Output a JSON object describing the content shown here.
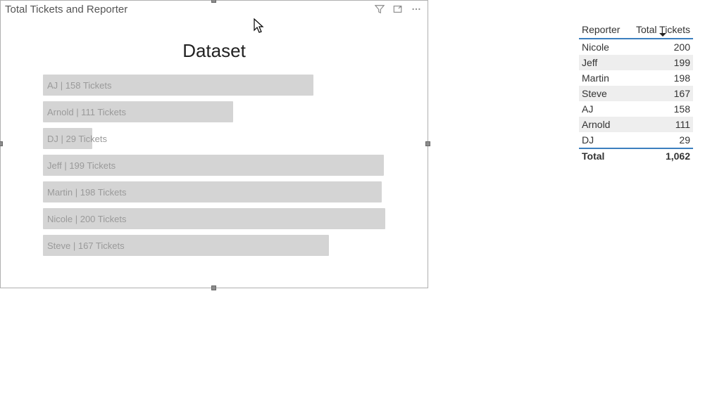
{
  "visual": {
    "title": "Total Tickets and Reporter",
    "chart_title": "Dataset"
  },
  "chart_data": {
    "type": "bar",
    "title": "Dataset",
    "xlabel": "",
    "ylabel": "",
    "orientation": "horizontal",
    "categories": [
      "AJ",
      "Arnold",
      "DJ",
      "Jeff",
      "Martin",
      "Nicole",
      "Steve"
    ],
    "values": [
      158,
      111,
      29,
      199,
      198,
      200,
      167
    ],
    "bar_labels": [
      "AJ | 158 Tickets",
      "Arnold | 111 Tickets",
      "DJ | 29 Tickets",
      "Jeff | 199 Tickets",
      "Martin | 198 Tickets",
      "Nicole | 200 Tickets",
      "Steve | 167 Tickets"
    ],
    "max_value": 200
  },
  "table": {
    "columns": [
      "Reporter",
      "Total Tickets"
    ],
    "sort_column": "Total Tickets",
    "sort_direction": "desc",
    "rows": [
      {
        "reporter": "Nicole",
        "tickets": "200"
      },
      {
        "reporter": "Jeff",
        "tickets": "199"
      },
      {
        "reporter": "Martin",
        "tickets": "198"
      },
      {
        "reporter": "Steve",
        "tickets": "167"
      },
      {
        "reporter": "AJ",
        "tickets": "158"
      },
      {
        "reporter": "Arnold",
        "tickets": "111"
      },
      {
        "reporter": "DJ",
        "tickets": "29"
      }
    ],
    "total_label": "Total",
    "total_value": "1,062"
  }
}
